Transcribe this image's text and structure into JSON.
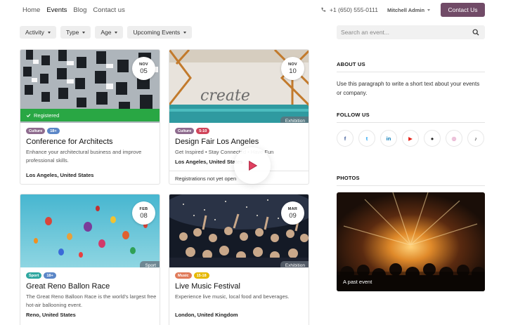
{
  "nav": {
    "links": [
      "Home",
      "Events",
      "Blog",
      "Contact us"
    ],
    "phone": "+1 (650) 555-0111",
    "user": "Mitchell Admin",
    "cta": "Contact Us"
  },
  "filters": [
    "Activity",
    "Type",
    "Age",
    "Upcoming Events"
  ],
  "search": {
    "placeholder": "Search an event..."
  },
  "events": [
    {
      "month": "NOV",
      "day": "05",
      "badge": "Registered",
      "tags": [
        {
          "label": "Culture",
          "color": "#8e6b8e"
        },
        {
          "label": "18+",
          "color": "#5b86c7"
        }
      ],
      "title": "Conference for Architects",
      "description": "Enhance your architectural business and improve professional skills.",
      "location": "Los Angeles, United States"
    },
    {
      "month": "NOV",
      "day": "10",
      "ribbon": "Exhibition",
      "tags": [
        {
          "label": "Culture",
          "color": "#8e6b8e"
        },
        {
          "label": "5-10",
          "color": "#d0445a"
        }
      ],
      "title": "Design Fair Los Angeles",
      "description": "Get Inspired • Stay Connected • Have Fun",
      "location": "Los Angeles, United States",
      "footer": "Registrations not yet open"
    },
    {
      "month": "FEB",
      "day": "08",
      "ribbon": "Sport",
      "tags": [
        {
          "label": "Sport",
          "color": "#2ea7a0"
        },
        {
          "label": "18+",
          "color": "#5b86c7"
        }
      ],
      "title": "Great Reno Ballon Race",
      "description": "The Great Reno Balloon Race is the world's largest free hot-air ballooning event.",
      "location": "Reno, United States"
    },
    {
      "month": "MAR",
      "day": "09",
      "ribbon": "Exhibition",
      "tags": [
        {
          "label": "Music",
          "color": "#e07b5a"
        },
        {
          "label": "15-18",
          "color": "#e6b800"
        }
      ],
      "title": "Live Music Festival",
      "description": "Experience live music, local food and beverages.",
      "location": "London, United Kingdom"
    }
  ],
  "sidebar": {
    "about_title": "ABOUT US",
    "about_text": "Use this paragraph to write a short text about your events or company.",
    "follow_title": "FOLLOW US",
    "social": [
      {
        "icon": "facebook-icon",
        "glyph": "f",
        "color": "#3b5998"
      },
      {
        "icon": "twitter-icon",
        "glyph": "t",
        "color": "#1da1f2"
      },
      {
        "icon": "linkedin-icon",
        "glyph": "in",
        "color": "#0077b5"
      },
      {
        "icon": "youtube-icon",
        "glyph": "▶",
        "color": "#e62117"
      },
      {
        "icon": "github-icon",
        "glyph": "●",
        "color": "#222222"
      },
      {
        "icon": "instagram-icon",
        "glyph": "◎",
        "color": "#c13584"
      },
      {
        "icon": "tiktok-icon",
        "glyph": "♪",
        "color": "#111111"
      }
    ],
    "photos_title": "PHOTOS",
    "photo_caption": "A past event"
  }
}
